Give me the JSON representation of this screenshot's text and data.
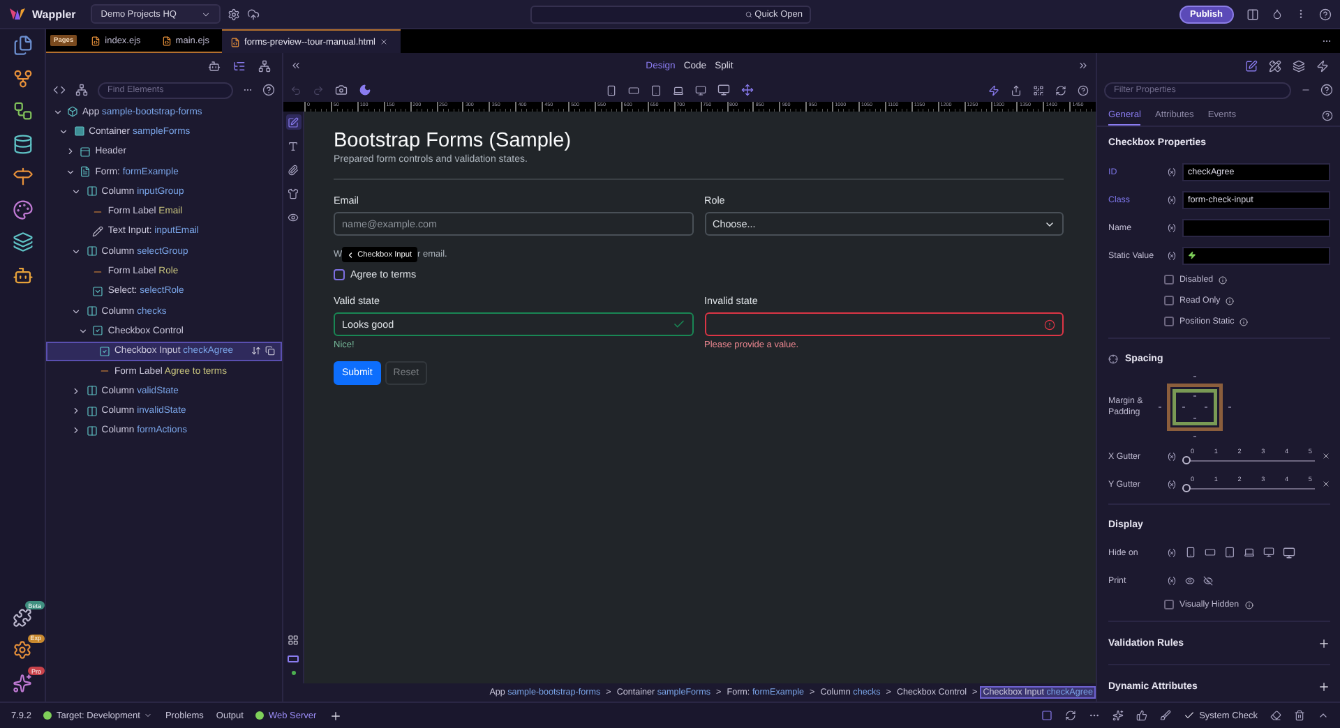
{
  "app": {
    "logo": "Wappler",
    "project": "Demo Projects HQ",
    "quick_open": "Quick Open",
    "publish": "Publish"
  },
  "rail_badges": [
    {
      "kind": "extensions",
      "badge": "Beta",
      "color": "#3f8f80"
    },
    {
      "kind": "settings",
      "badge": "Exp",
      "color": "#c9892e"
    },
    {
      "kind": "logo",
      "badge": "Pro",
      "color": "#c8424a"
    }
  ],
  "editor_tabs": {
    "section": "Pages",
    "files": [
      {
        "label": "index.ejs",
        "selected": false
      },
      {
        "label": "main.ejs",
        "selected": false
      },
      {
        "label": "forms-preview--tour-manual.html",
        "selected": true
      }
    ]
  },
  "structure": {
    "search_placeholder": "Find Elements",
    "tree": [
      {
        "kind": "app",
        "type": "App",
        "name": "sample-bootstrap-forms",
        "expanded": true,
        "selected": false,
        "children": [
          {
            "kind": "container",
            "type": "Container",
            "name": "sampleForms",
            "expanded": true,
            "selected": false,
            "children": [
              {
                "kind": "header",
                "type": "Header",
                "expanded": false,
                "selected": false
              },
              {
                "kind": "form",
                "type": "Form:",
                "name": "formExample",
                "expanded": true,
                "selected": false,
                "children": [
                  {
                    "kind": "column",
                    "type": "Column",
                    "name": "inputGroup",
                    "expanded": true,
                    "selected": false,
                    "children": [
                      {
                        "kind": "label",
                        "type": "Form Label",
                        "name": "Email",
                        "selected": false
                      },
                      {
                        "kind": "text-input",
                        "type": "Text Input:",
                        "name": "inputEmail",
                        "selected": false
                      }
                    ]
                  },
                  {
                    "kind": "column",
                    "type": "Column",
                    "name": "selectGroup",
                    "expanded": true,
                    "selected": false,
                    "children": [
                      {
                        "kind": "label",
                        "type": "Form Label",
                        "name": "Role",
                        "selected": false
                      },
                      {
                        "kind": "select",
                        "type": "Select:",
                        "name": "selectRole",
                        "selected": false
                      }
                    ]
                  },
                  {
                    "kind": "column",
                    "type": "Column",
                    "name": "checks",
                    "expanded": true,
                    "selected": false,
                    "children": [
                      {
                        "kind": "checkbox",
                        "type": "Checkbox Control",
                        "expanded": true,
                        "selected": false,
                        "children": [
                          {
                            "kind": "checkbox",
                            "type": "Checkbox Input",
                            "name": "checkAgree",
                            "selected": true
                          },
                          {
                            "kind": "label",
                            "type": "Form Label",
                            "name": "Agree to terms",
                            "selected": false
                          }
                        ]
                      }
                    ]
                  },
                  {
                    "kind": "column",
                    "type": "Column",
                    "name": "validState",
                    "expanded": false,
                    "selected": false
                  },
                  {
                    "kind": "column",
                    "type": "Column",
                    "name": "invalidState",
                    "expanded": false,
                    "selected": false
                  },
                  {
                    "kind": "column",
                    "type": "Column",
                    "name": "formActions",
                    "expanded": false,
                    "selected": false
                  }
                ]
              }
            ]
          }
        ]
      }
    ]
  },
  "view_modes": [
    {
      "label": "Design",
      "selected": true
    },
    {
      "label": "Code",
      "selected": false
    },
    {
      "label": "Split",
      "selected": false
    }
  ],
  "ruler": [
    "0",
    "50",
    "100",
    "150",
    "200",
    "250",
    "300",
    "350",
    "400",
    "450",
    "500",
    "550",
    "600",
    "650",
    "700",
    "750",
    "800",
    "850",
    "900",
    "950",
    "1000",
    "1050",
    "1100",
    "1150",
    "1200",
    "1250",
    "1300",
    "1350",
    "1400",
    "1450"
  ],
  "page": {
    "title": "Bootstrap Forms (Sample)",
    "subtitle": "Prepared form controls and validation states.",
    "email": {
      "label": "Email",
      "placeholder": "name@example.com",
      "help_start": "W",
      "help_end": "r email."
    },
    "tooltip": "Checkbox Input",
    "role": {
      "label": "Role",
      "value": "Choose..."
    },
    "agree": {
      "label": "Agree to terms",
      "checked": false
    },
    "valid": {
      "label": "Valid state",
      "value": "Looks good",
      "feedback": "Nice!"
    },
    "invalid": {
      "label": "Invalid state",
      "feedback": "Please provide a value."
    },
    "buttons": [
      {
        "label": "Submit",
        "kind": "primary",
        "disabled": false
      },
      {
        "label": "Reset",
        "kind": "secondary",
        "disabled": true
      }
    ]
  },
  "breadcrumb": {
    "separator": ">",
    "items": [
      {
        "type": "App",
        "name": "sample-bootstrap-forms",
        "selected": false
      },
      {
        "type": "Container",
        "name": "sampleForms",
        "selected": false
      },
      {
        "type": "Form:",
        "name": "formExample",
        "selected": false
      },
      {
        "type": "Column",
        "name": "checks",
        "selected": false
      },
      {
        "type": "Checkbox Control",
        "selected": false
      },
      {
        "type": "Checkbox Input",
        "name": "checkAgree",
        "selected": true
      }
    ]
  },
  "properties": {
    "filter_placeholder": "Filter Properties",
    "tabs": [
      {
        "label": "General",
        "selected": true
      },
      {
        "label": "Attributes",
        "selected": false
      },
      {
        "label": "Events",
        "selected": false
      }
    ],
    "heading": "Checkbox Properties",
    "fields": [
      {
        "label": "ID",
        "value": "checkAgree"
      },
      {
        "label": "Class",
        "value": "form-check-input"
      },
      {
        "label": "Name"
      },
      {
        "label": "Static Value",
        "kind": "dynamic"
      }
    ],
    "options": [
      {
        "label": "Disabled",
        "checked": false
      },
      {
        "label": "Read Only",
        "checked": false
      },
      {
        "label": "Position Static",
        "checked": false
      }
    ],
    "spacing": {
      "title": "Spacing",
      "box_label": "Margin & Padding",
      "gutters": [
        {
          "label": "X Gutter",
          "ticks": [
            "0",
            "1",
            "2",
            "3",
            "4",
            "5"
          ],
          "level": 0
        },
        {
          "label": "Y Gutter",
          "ticks": [
            "0",
            "1",
            "2",
            "3",
            "4",
            "5"
          ],
          "level": 0
        }
      ]
    },
    "display": {
      "title": "Display",
      "hide_on": "Hide on",
      "print": "Print",
      "visually_hidden": {
        "label": "Visually Hidden",
        "checked": false
      }
    },
    "sections": [
      "Validation Rules",
      "Dynamic Attributes"
    ]
  },
  "status": {
    "version": "7.9.2",
    "target": "Target: Development",
    "items": [
      "Problems",
      "Output"
    ],
    "server": "Web Server",
    "system_check": "System Check"
  }
}
